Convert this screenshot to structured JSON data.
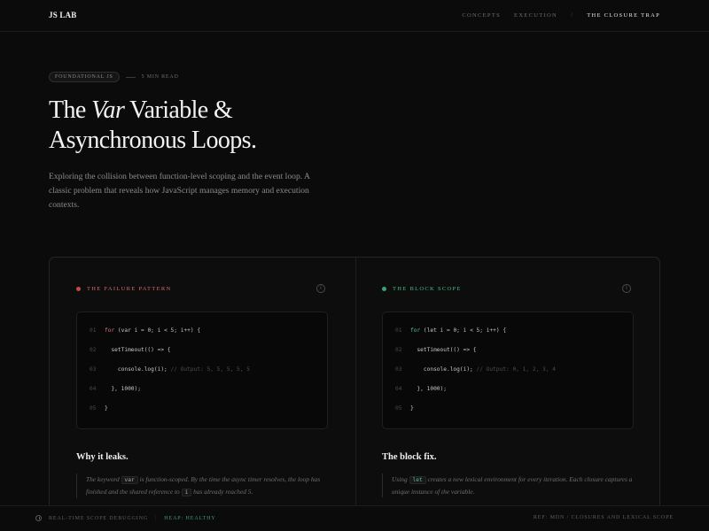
{
  "nav": {
    "brand": "JS LAB",
    "links": [
      {
        "label": "Concepts"
      },
      {
        "label": "Execution"
      },
      {
        "label": "The Closure Trap"
      }
    ],
    "separator": "/"
  },
  "hero": {
    "tag": "Foundational JS",
    "read_time": "5 min read",
    "title_part1": "The ",
    "title_em": "Var",
    "title_part2": " Variable &",
    "title_line2": "Asynchronous Loops.",
    "intro": "Exploring the collision between function-level scoping and the event loop. A classic problem that reveals how JavaScript manages memory and execution contexts."
  },
  "panels": {
    "failure": {
      "label": "The Failure Pattern",
      "accent": "#c4474a",
      "info_icon": "info-icon",
      "code": [
        {
          "num": "01",
          "kw": "for",
          "text": " (var i = 0; i < 5; i++) {",
          "comment": ""
        },
        {
          "num": "02",
          "kw": "",
          "text": "  setTimeout(() => {",
          "comment": ""
        },
        {
          "num": "03",
          "kw": "",
          "text": "    console.log(i); ",
          "comment": "// Output: 5, 5, 5, 5, 5"
        },
        {
          "num": "04",
          "kw": "",
          "text": "  }, 1000);",
          "comment": ""
        },
        {
          "num": "05",
          "kw": "",
          "text": "}",
          "comment": ""
        }
      ],
      "heading": "Why it leaks.",
      "explain_pre": "The keyword ",
      "explain_code": "var",
      "explain_mid": " is function-scoped. By the time the async timer resolves, the loop has finished and the shared reference to ",
      "explain_code2": "i",
      "explain_post": " has already reached 5."
    },
    "fix": {
      "label": "The Block Scope",
      "accent": "#3aa373",
      "info_icon": "info-icon",
      "code": [
        {
          "num": "01",
          "kw": "for",
          "text": " (let i = 0; i < 5; i++) {",
          "comment": ""
        },
        {
          "num": "02",
          "kw": "",
          "text": "  setTimeout(() => {",
          "comment": ""
        },
        {
          "num": "03",
          "kw": "",
          "text": "    console.log(i); ",
          "comment": "// Output: 0, 1, 2, 3, 4"
        },
        {
          "num": "04",
          "kw": "",
          "text": "  }, 1000);",
          "comment": ""
        },
        {
          "num": "05",
          "kw": "",
          "text": "}",
          "comment": ""
        }
      ],
      "heading": "The block fix.",
      "explain_pre": "Using ",
      "explain_code": "let",
      "explain_post": " creates a new lexical environment for every iteration. Each closure captures a unique instance of the variable."
    }
  },
  "footer": {
    "status": "Real-time scope debugging",
    "separator": "|",
    "heap": "Heap: Healthy",
    "ref": "Ref: MDN / Closures and Lexical Scope"
  }
}
